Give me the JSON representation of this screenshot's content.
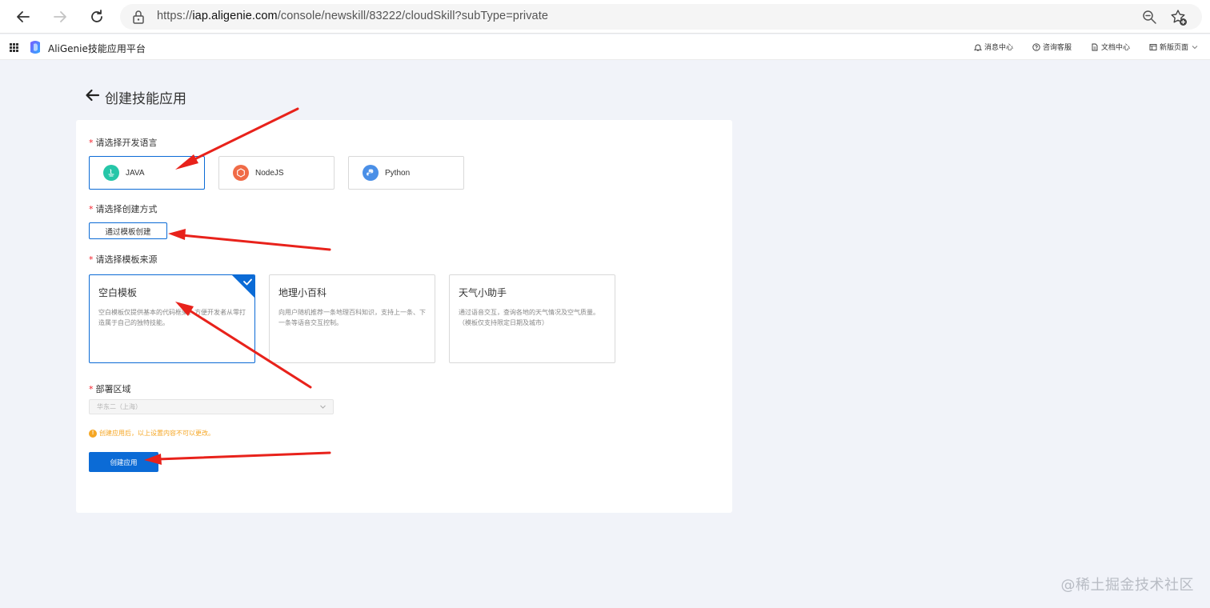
{
  "browser": {
    "url_prefix": "https://",
    "url_domain": "iap.aligenie.com",
    "url_path": "/console/newskill/83222/cloudSkill?subType=private"
  },
  "header": {
    "app_title": "AliGenie技能应用平台",
    "links": [
      "消息中心",
      "咨询客服",
      "文档中心",
      "新版页面"
    ]
  },
  "page": {
    "title": "创建技能应用"
  },
  "form": {
    "language_label": "请选择开发语言",
    "languages": [
      {
        "name": "JAVA",
        "color": "#26c6a8"
      },
      {
        "name": "NodeJS",
        "color": "#f06b47"
      },
      {
        "name": "Python",
        "color": "#4a8fe7"
      }
    ],
    "method_label": "请选择创建方式",
    "method_option": "通过模板创建",
    "template_label": "请选择模板来源",
    "templates": [
      {
        "title": "空白模板",
        "desc": "空白模板仅提供基本的代码框架，方便开发者从零打造属于自己的独特技能。"
      },
      {
        "title": "地理小百科",
        "desc": "向用户随机推荐一条地理百科知识，支持上一条、下一条等语音交互控制。"
      },
      {
        "title": "天气小助手",
        "desc": "通过语音交互，查询各地的天气情况及空气质量。（模板仅支持限定日期及城市）"
      }
    ],
    "region_label": "部署区域",
    "region_value": "华东二（上海）",
    "notice": "创建应用后，以上设置内容不可以更改。",
    "create_button": "创建应用"
  },
  "watermark": "@稀土掘金技术社区",
  "colors": {
    "accent": "#0b6bd6",
    "required": "#f5222d",
    "warning": "#f5a623",
    "annotation_arrow": "#e8221b"
  }
}
